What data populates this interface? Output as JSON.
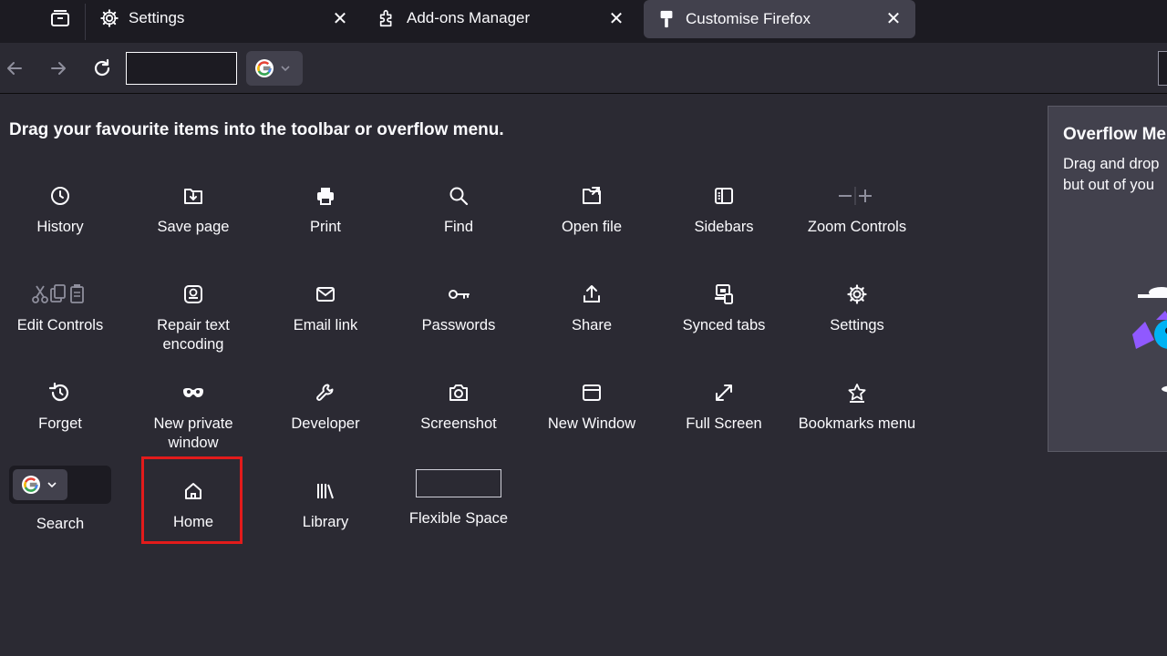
{
  "tabs": [
    {
      "label": "Settings",
      "icon": "gear-icon"
    },
    {
      "label": "Add-ons Manager",
      "icon": "puzzle-icon"
    },
    {
      "label": "Customise Firefox",
      "icon": "paintbrush-icon",
      "active": true
    }
  ],
  "heading": "Drag your favourite items into the toolbar or overflow menu.",
  "palette": [
    {
      "label": "History",
      "icon": "clock-icon"
    },
    {
      "label": "Save page",
      "icon": "save-page-icon"
    },
    {
      "label": "Print",
      "icon": "printer-icon"
    },
    {
      "label": "Find",
      "icon": "search-icon"
    },
    {
      "label": "Open file",
      "icon": "open-file-icon"
    },
    {
      "label": "Sidebars",
      "icon": "sidebar-icon"
    },
    {
      "label": "Zoom Controls",
      "icon": "zoom-controls-icon"
    },
    {
      "label": "Edit Controls",
      "icon": "edit-controls-icon"
    },
    {
      "label": "Repair text encoding",
      "icon": "text-encoding-icon"
    },
    {
      "label": "Email link",
      "icon": "envelope-icon"
    },
    {
      "label": "Passwords",
      "icon": "key-icon"
    },
    {
      "label": "Share",
      "icon": "share-icon"
    },
    {
      "label": "Synced tabs",
      "icon": "synced-tabs-icon"
    },
    {
      "label": "Settings",
      "icon": "gear-icon"
    },
    {
      "label": "Forget",
      "icon": "forget-icon"
    },
    {
      "label": "New private window",
      "icon": "private-mask-icon"
    },
    {
      "label": "Developer",
      "icon": "wrench-icon"
    },
    {
      "label": "Screenshot",
      "icon": "camera-icon"
    },
    {
      "label": "New Window",
      "icon": "window-icon"
    },
    {
      "label": "Full Screen",
      "icon": "fullscreen-icon"
    },
    {
      "label": "Bookmarks menu",
      "icon": "bookmark-star-icon"
    },
    {
      "label": "Search",
      "icon": "google-icon"
    },
    {
      "label": "Home",
      "icon": "home-icon"
    },
    {
      "label": "Library",
      "icon": "library-icon"
    },
    {
      "label": "Flexible Space",
      "icon": "flexible-space-box"
    }
  ],
  "overflow": {
    "title": "Overflow Me",
    "desc_line1": "Drag and drop",
    "desc_line2": "but out of you"
  },
  "colors": {
    "background": "#2b2a33",
    "tabstrip": "#1c1b22",
    "active_tab": "#42414d",
    "highlight": "#e21b1b"
  }
}
